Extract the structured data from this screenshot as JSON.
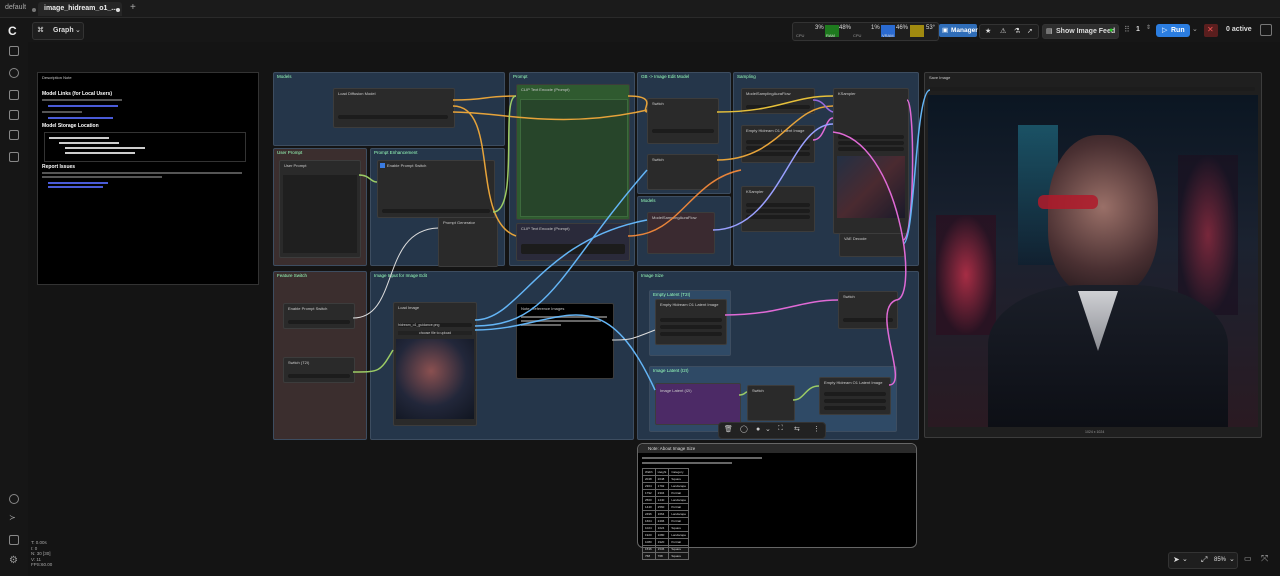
{
  "tabs": {
    "workspace": "default",
    "active_tab": "image_hidream_o1_...",
    "new_tab": "+"
  },
  "toolbar": {
    "mode": "Graph",
    "cpu_label": "CPU",
    "ram_label": "RAM",
    "vram_label": "VRAM",
    "cpu1": "3%",
    "ram1": "48%",
    "cpu2": "1%",
    "vram": "46%",
    "temp": "53°",
    "manager": "Manager",
    "show_feed": "Show Image Feed",
    "queue_count": "1",
    "run": "Run",
    "active": "0 active"
  },
  "colors": {
    "accent": "#2f7bd8",
    "run": "#2b7de0",
    "group": "#2b3a4c",
    "prompt_group": "#3a2a2a",
    "green_node": "#2f5a2f",
    "purple": "#5a2c76",
    "note_bg": "#000000"
  },
  "notes_panel": {
    "title": "Description Note",
    "h_links": "Model Links (for Local Users)",
    "h_storage": "Model Storage Location",
    "h_report": "Report Issues"
  },
  "groups": {
    "models": "Models",
    "prompt": "Prompt",
    "g2i": "GB -> Image Edit Model",
    "sampling": "Sampling",
    "user_prompt": "User Prompt",
    "prompt_enh": "Prompt Enhancement",
    "feature": "Feature Switch",
    "image_input": "Image Input for Image Edit",
    "image_size": "Image Size",
    "latent_t2i": "Empty Latent (T2I)",
    "image_latent": "Image Latent (I2I)",
    "result": "Save Image"
  },
  "nodes": {
    "load_diffusion": "Load Diffusion Model",
    "clip_pos": "CLIP Text Encode (Prompt)",
    "clip_neg": "CLIP Text Encode (Prompt)",
    "switch1": "Switch",
    "switch2": "Switch",
    "ksampler": "KSampler",
    "vae_decode": "VAE Decode",
    "model_sampling": "ModelSamplingAuraFlow",
    "load_image": "Load Image",
    "image_file": "hidream_o1_guidance.png",
    "upload": "choose file to upload",
    "note_refs": "Note: Reference Images",
    "note_size": "Note: About Image Size",
    "save_image": "Save Image",
    "empty_latent": "Empty Hidream O1 Latent Image",
    "user_prompt": "User Prompt",
    "switch_t2i": "Switch (T2I)",
    "enable_enh": "Enable Prompt Switch",
    "prompt_gen": "Prompt Generator"
  },
  "size_table": {
    "headers": [
      "Width",
      "Height",
      "Category"
    ],
    "rows": [
      [
        "2048",
        "2048",
        "Square"
      ],
      [
        "2304",
        "1792",
        "Landscape"
      ],
      [
        "1792",
        "2304",
        "Portrait"
      ],
      [
        "2560",
        "1440",
        "Landscape"
      ],
      [
        "1440",
        "2560",
        "Portrait"
      ],
      [
        "2496",
        "1664",
        "Landscape"
      ],
      [
        "1664",
        "2496",
        "Portrait"
      ],
      [
        "1024",
        "1024",
        "Square"
      ],
      [
        "1920",
        "1080",
        "Landscape"
      ],
      [
        "1080",
        "1920",
        "Portrait"
      ],
      [
        "1536",
        "1536",
        "Square"
      ],
      [
        "768",
        "768",
        "Square"
      ]
    ]
  },
  "status": {
    "fps": "fps",
    "zoom": "85%",
    "info_lines": [
      "T: 0.00s",
      "I: 0",
      "N: 30 [30]",
      "V: 11",
      "FPS:60.00"
    ]
  },
  "save_image_caption": "1024 x 1024"
}
